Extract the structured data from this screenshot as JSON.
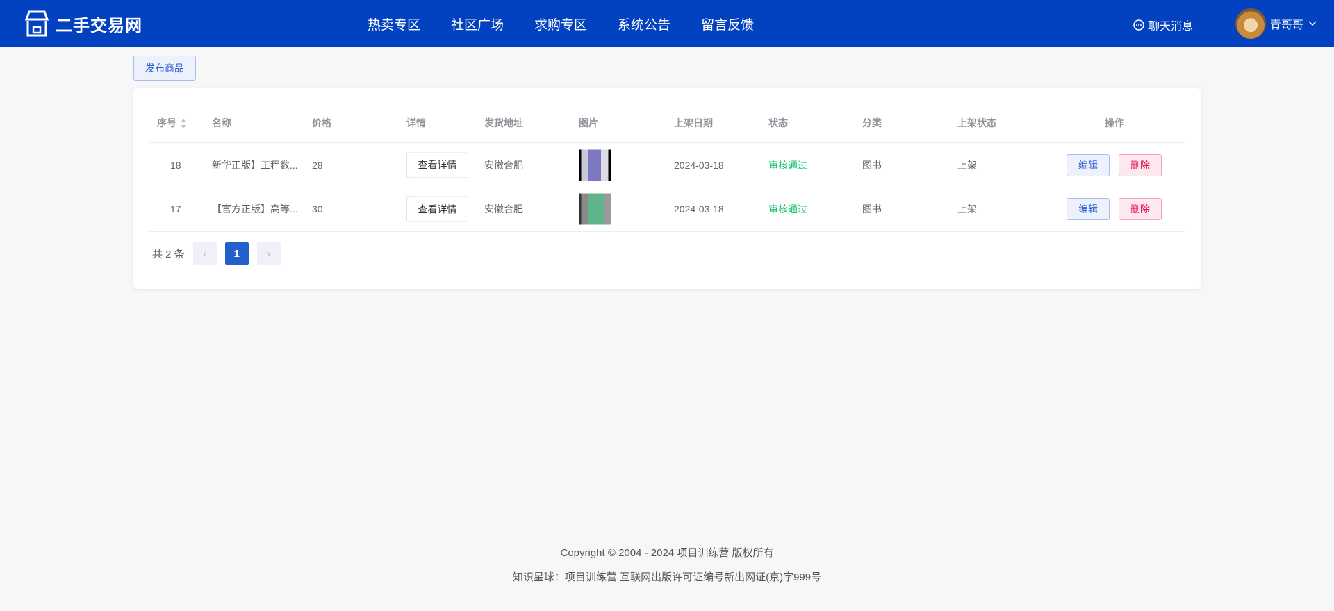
{
  "header": {
    "logo_text": "二手交易网",
    "nav": [
      "热卖专区",
      "社区广场",
      "求购专区",
      "系统公告",
      "留言反馈"
    ],
    "chat_label": "聊天消息",
    "user_name": "青哥哥"
  },
  "toolbar": {
    "publish_label": "发布商品"
  },
  "table": {
    "columns": [
      "序号",
      "名称",
      "价格",
      "详情",
      "发货地址",
      "图片",
      "上架日期",
      "状态",
      "分类",
      "上架状态",
      "操作"
    ],
    "rows": [
      {
        "id": "18",
        "name": "新华正版】工程数...",
        "price": "28",
        "detail": "查看详情",
        "address": "安徽合肥",
        "date": "2024-03-18",
        "status": "审核通过",
        "category": "图书",
        "shelf": "上架",
        "edit": "编辑",
        "delete": "删除"
      },
      {
        "id": "17",
        "name": "【官方正版】高等...",
        "price": "30",
        "detail": "查看详情",
        "address": "安徽合肥",
        "date": "2024-03-18",
        "status": "审核通过",
        "category": "图书",
        "shelf": "上架",
        "edit": "编辑",
        "delete": "删除"
      }
    ]
  },
  "pagination": {
    "total_label": "共 2 条",
    "current_page": "1",
    "prev": "‹",
    "next": "›"
  },
  "footer": {
    "copyright": "Copyright © 2004 - 2024 项目训练营 版权所有",
    "license": "知识星球：项目训练营 互联网出版许可证编号新出网证(京)字999号"
  },
  "colors": {
    "brand": "#0241bf",
    "status_ok": "#13c26a",
    "delete": "#e6164d"
  }
}
